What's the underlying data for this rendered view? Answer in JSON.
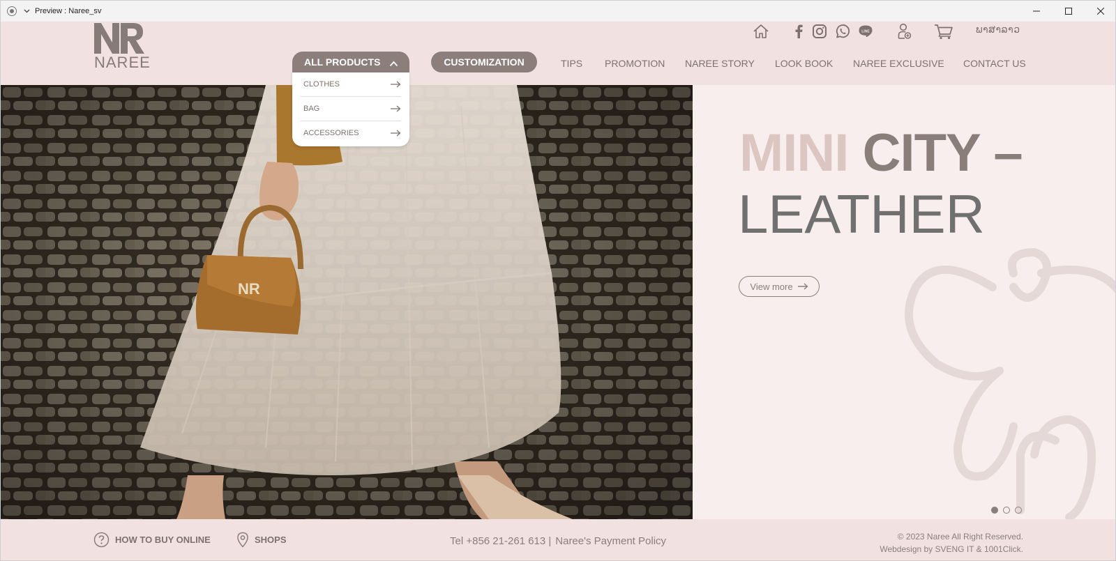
{
  "window": {
    "title": "Preview : Naree_sv"
  },
  "logo": {
    "monogram": "NR",
    "wordmark": "NAREE"
  },
  "top_bar": {
    "icons": [
      "home-icon",
      "facebook-icon",
      "instagram-icon",
      "whatsapp-icon",
      "line-icon",
      "account-icon",
      "cart-icon"
    ],
    "language_label": "ພາສາລາວ"
  },
  "nav": {
    "all_products": "ALL PRODUCTS",
    "customization": "CUSTOMIZATION",
    "items": [
      "TIPS",
      "PROMOTION",
      "NAREE STORY",
      "LOOK BOOK",
      "NAREE EXCLUSIVE",
      "CONTACT US"
    ]
  },
  "dropdown": {
    "items": [
      "CLOTHES",
      "BAG",
      "ACCESSORIES"
    ]
  },
  "hero": {
    "headline_light": "MINI",
    "headline_dark": "CITY –",
    "headline_line2": "LEATHER",
    "bag_monogram": "NR",
    "cta": "View more",
    "slides_total": 3,
    "active_slide": 1
  },
  "footer": {
    "how_to_buy": "HOW TO BUY ONLINE",
    "shops": "SHOPS",
    "tel": "Tel +856 21-261 613 |",
    "payment_policy": "Naree's Payment Policy",
    "copyright": "© 2023 Naree All Right Reserved.",
    "credit": "Webdesign by SVENG IT & 1001Click."
  },
  "colors": {
    "header_bg": "#f1e2e1",
    "hero_panel_bg": "#f8eeed",
    "pill": "#8c7f7b",
    "text_muted": "#7d716e",
    "headline_light": "#dcc6c1",
    "headline_dark": "#8a7e7b",
    "headline_gray": "#707070"
  }
}
